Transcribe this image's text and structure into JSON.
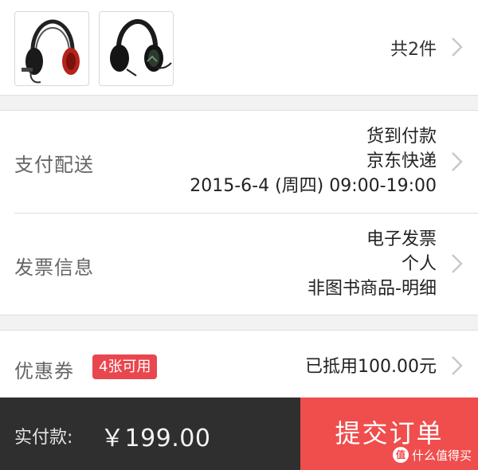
{
  "products": {
    "count_text": "共2件",
    "items": [
      {
        "icon": "headset-red-icon"
      },
      {
        "icon": "headset-black-icon"
      }
    ]
  },
  "delivery": {
    "label": "支付配送",
    "payment": "货到付款",
    "courier": "京东快递",
    "time": "2015-6-4  (周四)  09:00-19:00"
  },
  "invoice": {
    "label": "发票信息",
    "type": "电子发票",
    "title": "个人",
    "content": "非图书商品-明细"
  },
  "coupon": {
    "label": "优惠券",
    "badge": "4张可用",
    "value": "已抵用100.00元"
  },
  "footer": {
    "pay_label": "实付款:",
    "amount": "￥199.00",
    "submit_label": "提交订单",
    "watermark": "什么值得买",
    "watermark_icon_text": "值"
  },
  "colors": {
    "accent": "#ef4e4d",
    "badge": "#e8474e",
    "footer_dark": "#2f2f30"
  }
}
